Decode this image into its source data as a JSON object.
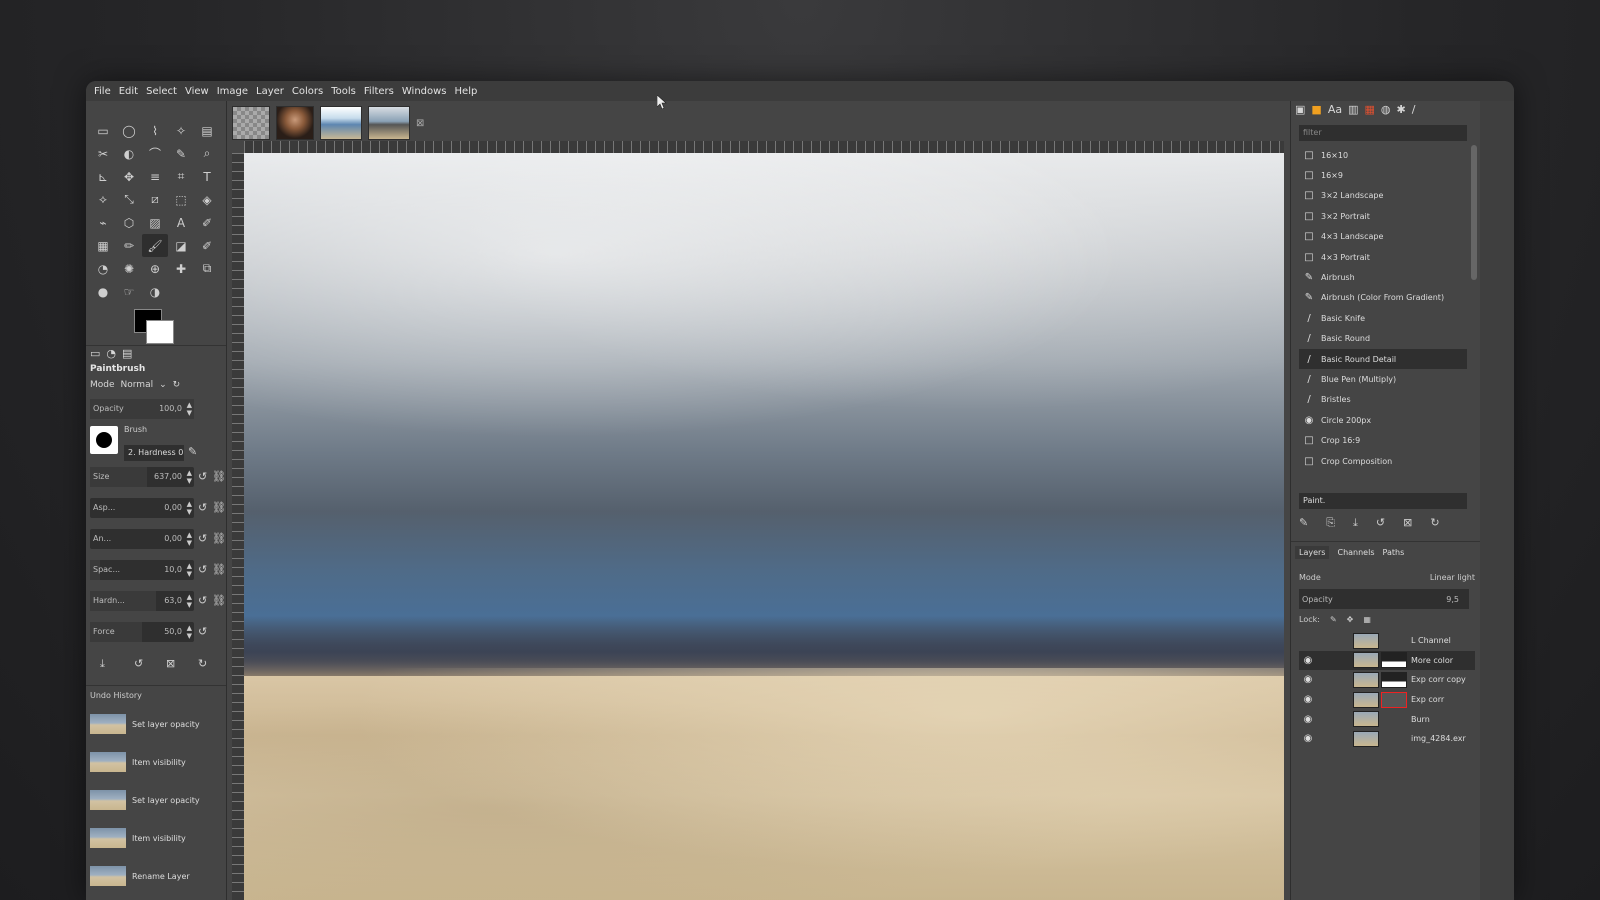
{
  "menu": [
    "File",
    "Edit",
    "Select",
    "View",
    "Image",
    "Layer",
    "Colors",
    "Tools",
    "Filters",
    "Windows",
    "Help"
  ],
  "toolbox": {
    "tool_icons": [
      "rect-select-icon",
      "ellipse-select-icon",
      "free-select-icon",
      "fuzzy-select-icon",
      "by-color-select-icon",
      "scissors-select-icon",
      "foreground-select-icon",
      "paths-icon",
      "color-picker-icon",
      "zoom-icon",
      "measure-icon",
      "move-icon",
      "align-icon",
      "crop-icon",
      "text-transform-icon",
      "unified-transform-icon",
      "scale-icon",
      "shear-icon",
      "perspective-icon",
      "3d-transform-icon",
      "warp-transform-icon",
      "cage-transform-icon",
      "bucket-fill-icon",
      "text-icon",
      "paintbrush-alt-icon",
      "gradient-icon",
      "pencil-icon",
      "paintbrush-icon",
      "eraser-icon",
      "airbrush-icon",
      "ink-icon",
      "mypaint-brush-icon",
      "clone-icon",
      "heal-icon",
      "perspective-clone-icon",
      "blur-icon",
      "smudge-icon",
      "dodge-burn-icon"
    ],
    "tool_glyphs": [
      "▭",
      "◯",
      "⌇",
      "✧",
      "▤",
      "✂",
      "◐",
      "⌒",
      "✎",
      "⌕",
      "⊾",
      "✥",
      "≡",
      "⌗",
      "T",
      "⟡",
      "⤡",
      "⧄",
      "⬚",
      "◈",
      "⌁",
      "⬡",
      "▨",
      "A",
      "✐",
      "▦",
      "✏",
      "🖌",
      "◪",
      "✐",
      "◔",
      "✺",
      "⊕",
      "✚",
      "⧉",
      "●",
      "☞",
      "◑"
    ],
    "tool_options_title": "Paintbrush",
    "mode_label": "Mode",
    "mode_value": "Normal",
    "opacity_label": "Opacity",
    "opacity_value": "100,0",
    "brush_label": "Brush",
    "brush_name": "2. Hardness 0",
    "sliders": [
      {
        "label": "Size",
        "value": "637,00"
      },
      {
        "label": "Asp...",
        "value": "0,00"
      },
      {
        "label": "An...",
        "value": "0,00"
      },
      {
        "label": "Spac...",
        "value": "10,0"
      },
      {
        "label": "Hardn...",
        "value": "63,0"
      },
      {
        "label": "Force",
        "value": "50,0"
      }
    ],
    "undo_title": "Undo History",
    "undo_items": [
      "Set layer opacity",
      "Item visibility",
      "Set layer opacity",
      "Item visibility",
      "Rename Layer"
    ]
  },
  "brushes": {
    "filter_placeholder": "filter",
    "items": [
      {
        "icon": "□",
        "label": "16×10"
      },
      {
        "icon": "□",
        "label": "16×9"
      },
      {
        "icon": "□",
        "label": "3×2 Landscape"
      },
      {
        "icon": "□",
        "label": "3×2 Portrait"
      },
      {
        "icon": "□",
        "label": "4×3 Landscape"
      },
      {
        "icon": "□",
        "label": "4×3 Portrait"
      },
      {
        "icon": "✎",
        "label": "Airbrush"
      },
      {
        "icon": "✎",
        "label": "Airbrush (Color From Gradient)"
      },
      {
        "icon": "/",
        "label": "Basic Knife"
      },
      {
        "icon": "/",
        "label": "Basic Round"
      },
      {
        "icon": "/",
        "label": "Basic Round Detail"
      },
      {
        "icon": "/",
        "label": "Blue Pen (Multiply)"
      },
      {
        "icon": "/",
        "label": "Bristles"
      },
      {
        "icon": "◉",
        "label": "Circle 200px"
      },
      {
        "icon": "□",
        "label": "Crop 16:9"
      },
      {
        "icon": "□",
        "label": "Crop Composition"
      }
    ],
    "selected_index": 10,
    "paint_select": "Paint."
  },
  "layers_panel": {
    "tabs": [
      "Layers",
      "Channels",
      "Paths"
    ],
    "mode_label": "Mode",
    "mode_value": "Linear light",
    "opacity_label": "Opacity",
    "opacity_value": "9,5",
    "lock_label": "Lock:",
    "layers": [
      {
        "name": "L Channel",
        "visible": false,
        "mask": false
      },
      {
        "name": "More color",
        "visible": true,
        "mask": true
      },
      {
        "name": "Exp corr copy",
        "visible": true,
        "mask": true
      },
      {
        "name": "Exp corr",
        "visible": true,
        "mask": true,
        "mask_selected": true
      },
      {
        "name": "Burn",
        "visible": true,
        "mask": false
      },
      {
        "name": "img_4284.exr",
        "visible": true,
        "mask": false
      }
    ],
    "selected_index": 1
  },
  "colors": {
    "fg": "#000000",
    "bg": "#ffffff"
  }
}
